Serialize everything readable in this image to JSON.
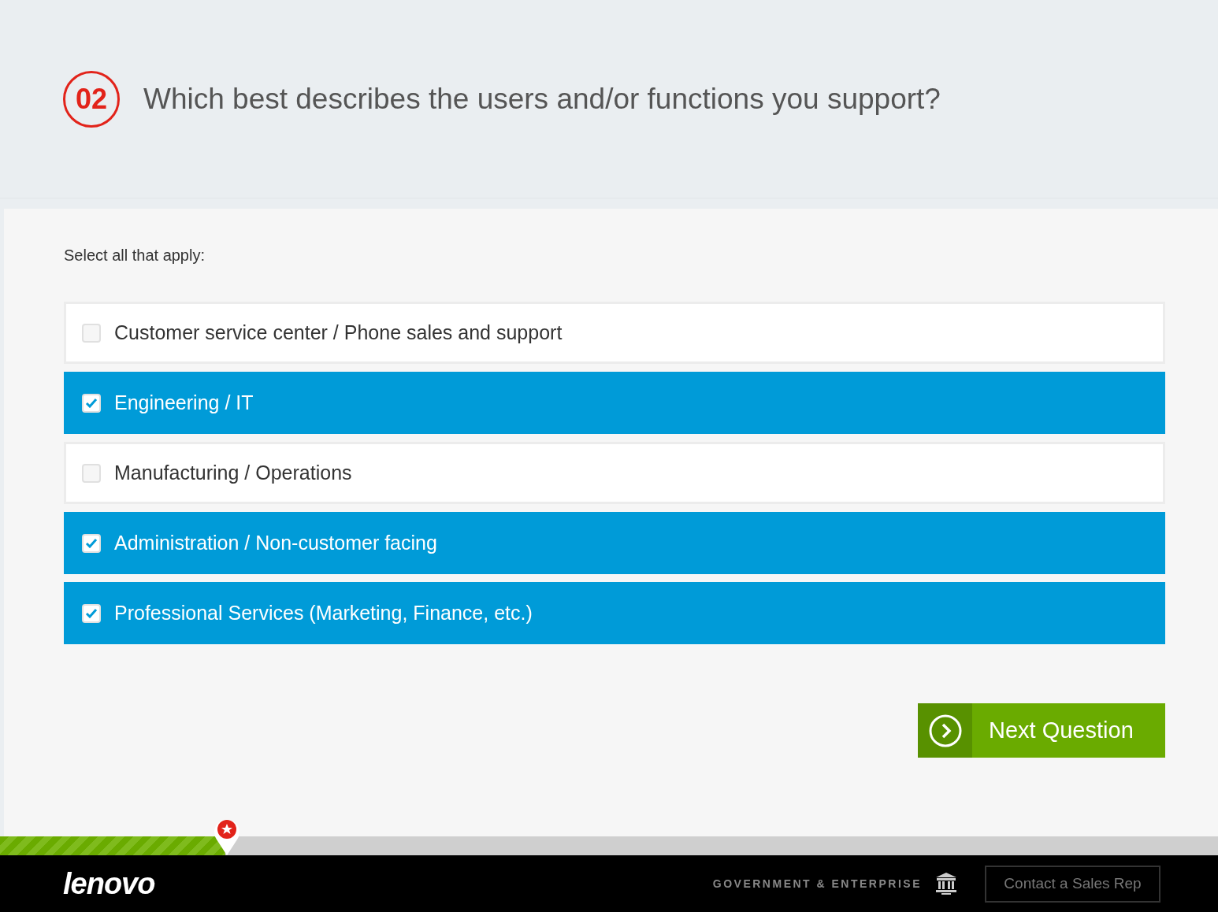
{
  "question": {
    "number": "02",
    "text": "Which best describes the users and/or functions you support?"
  },
  "instruction": "Select all that apply:",
  "options": [
    {
      "label": "Customer service center / Phone sales and support",
      "checked": false
    },
    {
      "label": "Engineering / IT",
      "checked": true
    },
    {
      "label": "Manufacturing / Operations",
      "checked": false
    },
    {
      "label": "Administration / Non-customer facing",
      "checked": true
    },
    {
      "label": "Professional Services (Marketing, Finance, etc.)",
      "checked": true
    }
  ],
  "next_button": "Next Question",
  "progress": {
    "level": 0.185
  },
  "footer": {
    "logo": "lenovo",
    "tagline": "GOVERNMENT & ENTERPRISE",
    "contact_button": "Contact a Sales Rep"
  }
}
